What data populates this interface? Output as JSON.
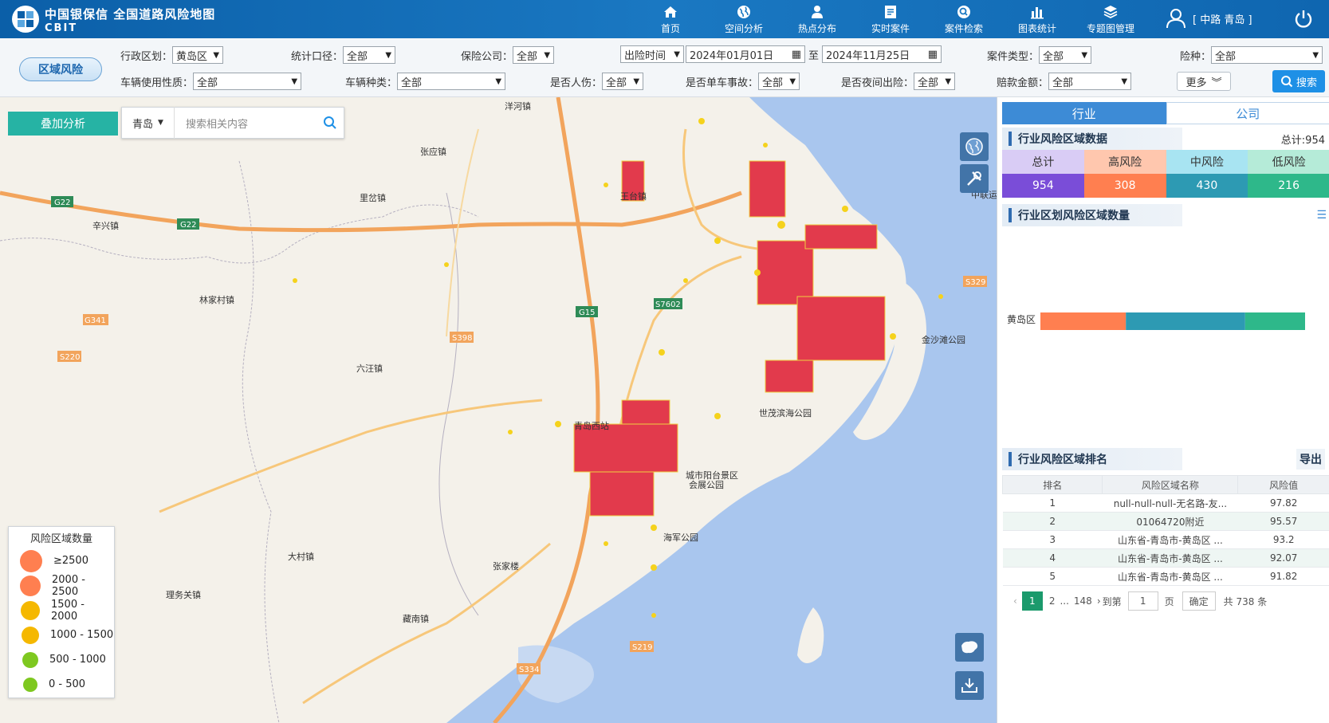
{
  "header": {
    "brand_cn": "中国银保信 全国道路风险地图",
    "brand_en": "CBIT",
    "nav": [
      {
        "label": "首页",
        "icon": "home-icon"
      },
      {
        "label": "空间分析",
        "icon": "globe-icon"
      },
      {
        "label": "热点分布",
        "icon": "map-pin-icon"
      },
      {
        "label": "实时案件",
        "icon": "document-icon"
      },
      {
        "label": "案件检索",
        "icon": "search-icon"
      },
      {
        "label": "图表统计",
        "icon": "bar-chart-icon"
      },
      {
        "label": "专题图管理",
        "icon": "layers-icon"
      }
    ],
    "user": "[ 中路 青岛 ]"
  },
  "filters": {
    "region_button": "区域风险",
    "admin_label": "行政区划：",
    "admin_value": "黄岛区",
    "stat_label": "统计口径：",
    "stat_value": "全部",
    "insurer_label": "保险公司：",
    "insurer_value": "全部",
    "time_type": "出险时间",
    "date_from": "2024年01月01日",
    "date_sep": "至",
    "date_to": "2024年11月25日",
    "case_label": "案件类型：",
    "case_value": "全部",
    "risk_label": "险种：",
    "risk_value": "全部",
    "usage_label": "车辆使用性质：",
    "usage_value": "全部",
    "vtype_label": "车辆种类：",
    "vtype_value": "全部",
    "injury_label": "是否人伤：",
    "injury_value": "全部",
    "single_label": "是否单车事故：",
    "single_value": "全部",
    "night_label": "是否夜间出险：",
    "night_value": "全部",
    "amount_label": "赔款金额：",
    "amount_value": "全部",
    "more": "更多",
    "search": "搜索"
  },
  "map": {
    "overlay_button": "叠加分析",
    "city": "青岛",
    "search_placeholder": "搜索相关内容",
    "labels": [
      "洋河镇",
      "张应镇",
      "里岔镇",
      "辛兴镇",
      "林家村镇",
      "六汪镇",
      "大村镇",
      "理务关镇",
      "藏南镇",
      "张家楼",
      "王台镇",
      "金沙滩公园",
      "世茂滨海公园",
      "青岛西站",
      "城市阳台景区",
      "会展公园",
      "海军公园",
      "中联运"
    ],
    "road_labels": [
      "G22",
      "G15",
      "S7602",
      "S398",
      "S220",
      "G341",
      "S329",
      "S219",
      "S334",
      "G22"
    ],
    "legend_title": "风险区域数量",
    "legend": [
      {
        "label": "≥2500",
        "color": "#ff7f50"
      },
      {
        "label": "2000 - 2500",
        "color": "#ff7f50"
      },
      {
        "label": "1500 - 2000",
        "color": "#f5b800"
      },
      {
        "label": "1000 - 1500",
        "color": "#f5b800"
      },
      {
        "label": "500 - 1000",
        "color": "#7ec820"
      },
      {
        "label": "0 - 500",
        "color": "#7ec820"
      }
    ]
  },
  "panel": {
    "tabs": [
      "行业",
      "公司"
    ],
    "area_title": "行业风险区域数据",
    "area_total": "总计:954",
    "summary": [
      {
        "label": "总计",
        "value": "954",
        "head": "#d9ccf5",
        "color": "#7a4dd8"
      },
      {
        "label": "高风险",
        "value": "308",
        "head": "#ffc7ae",
        "color": "#ff7f50"
      },
      {
        "label": "中风险",
        "value": "430",
        "head": "#a8e4f2",
        "color": "#2d9ab3"
      },
      {
        "label": "低风险",
        "value": "216",
        "head": "#b5ebd8",
        "color": "#2eb88a"
      }
    ],
    "count_title": "行业区划风险区域数量",
    "chart_data": {
      "type": "bar",
      "categories": [
        "黄岛区"
      ],
      "series": [
        {
          "name": "高风险",
          "values": [
            308
          ],
          "color": "#ff7f50"
        },
        {
          "name": "中风险",
          "values": [
            430
          ],
          "color": "#2d9ab3"
        },
        {
          "name": "低风险",
          "values": [
            216
          ],
          "color": "#2eb88a"
        }
      ],
      "stacked": true,
      "orientation": "horizontal"
    },
    "rank_title": "行业风险区域排名",
    "export": "导出",
    "columns": [
      "排名",
      "风险区域名称",
      "风险值"
    ],
    "rows": [
      [
        "1",
        "null-null-null-无名路-友...",
        "97.82"
      ],
      [
        "2",
        "01064720附近",
        "95.57"
      ],
      [
        "3",
        "山东省-青岛市-黄岛区 ...",
        "93.2"
      ],
      [
        "4",
        "山东省-青岛市-黄岛区 ...",
        "92.07"
      ],
      [
        "5",
        "山东省-青岛市-黄岛区 ...",
        "91.82"
      ]
    ],
    "pager": {
      "current": "1",
      "p2": "2",
      "ellipsis": "...",
      "last": "148",
      "goto": "到第",
      "page_input": "1",
      "page": "页",
      "confirm": "确定",
      "total": "共 738 条"
    }
  }
}
